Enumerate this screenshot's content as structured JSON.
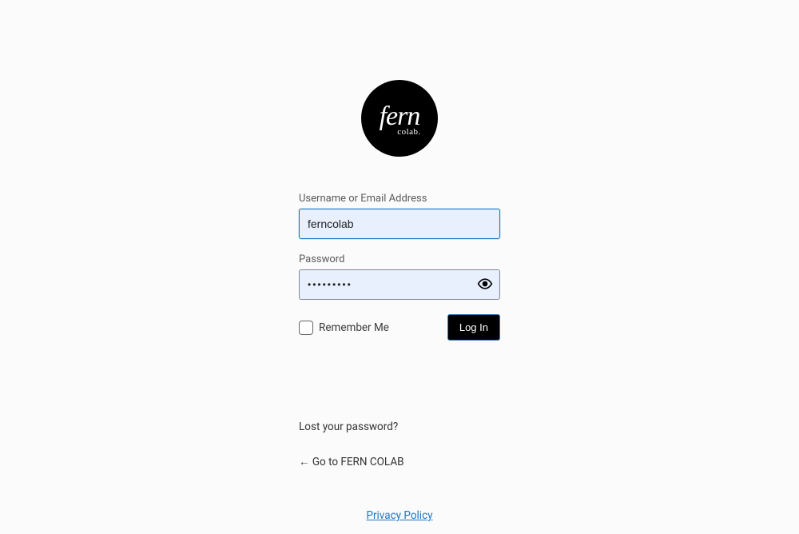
{
  "logo": {
    "main": "fern",
    "sub": "colab."
  },
  "form": {
    "username_label": "Username or Email Address",
    "username_value": "ferncolab",
    "password_label": "Password",
    "password_value": "•••••••••",
    "remember_label": "Remember Me",
    "submit_label": "Log In"
  },
  "links": {
    "lost_password": "Lost your password?",
    "back_to_site": "← Go to FERN COLAB",
    "privacy": "Privacy Policy"
  }
}
